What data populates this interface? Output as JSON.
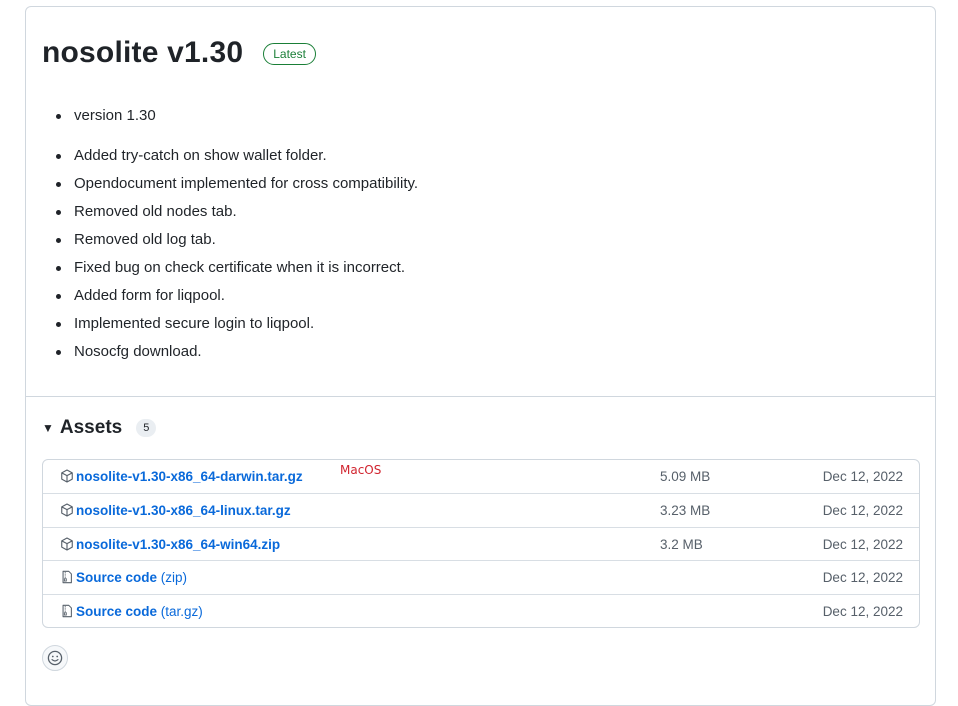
{
  "release": {
    "title": "nosolite v1.30",
    "badge": "Latest",
    "version_note": "version 1.30",
    "changes": [
      "Added try-catch on show wallet folder.",
      "Opendocument implemented for cross compatibility.",
      "Removed old nodes tab.",
      "Removed old log tab.",
      "Fixed bug on check certificate when it is incorrect.",
      "Added form for liqpool.",
      "Implemented secure login to liqpool.",
      "Nosocfg download."
    ]
  },
  "assets": {
    "caret_icon": "triangle-down-icon",
    "title": "Assets",
    "count": "5",
    "annotation": "MacOS",
    "items": [
      {
        "name": "nosolite-v1.30-x86_64-darwin.tar.gz",
        "suffix": "",
        "size": "5.09 MB",
        "date": "Dec 12, 2022",
        "icon": "package-icon"
      },
      {
        "name": "nosolite-v1.30-x86_64-linux.tar.gz",
        "suffix": "",
        "size": "3.23 MB",
        "date": "Dec 12, 2022",
        "icon": "package-icon"
      },
      {
        "name": "nosolite-v1.30-x86_64-win64.zip",
        "suffix": "",
        "size": "3.2 MB",
        "date": "Dec 12, 2022",
        "icon": "package-icon"
      },
      {
        "name": "Source code",
        "suffix": " (zip)",
        "size": "",
        "date": "Dec 12, 2022",
        "icon": "file-zip-icon"
      },
      {
        "name": "Source code",
        "suffix": " (tar.gz)",
        "size": "",
        "date": "Dec 12, 2022",
        "icon": "file-zip-icon"
      }
    ]
  },
  "reactions": {
    "icon": "smiley-icon"
  },
  "colors": {
    "link": "#0969da",
    "latest": "#1a7f37",
    "annotation": "#d1242f"
  }
}
